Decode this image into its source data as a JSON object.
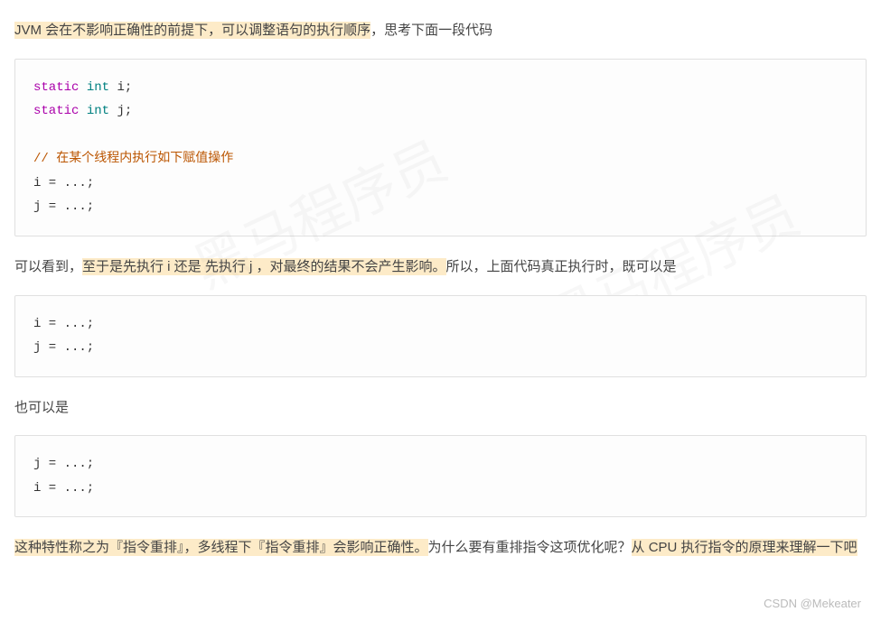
{
  "para1": {
    "hl": "JVM 会在不影响正确性的前提下，可以调整语句的执行顺序",
    "rest": "，思考下面一段代码"
  },
  "code1": {
    "line1_kw1": "static",
    "line1_kw2": "int",
    "line1_var": " i;",
    "line2_kw1": "static",
    "line2_kw2": "int",
    "line2_var": " j;",
    "comment": "// 在某个线程内执行如下赋值操作",
    "line3": "i = ...;",
    "line4": "j = ...;"
  },
  "para2": {
    "pre": "可以看到，",
    "hl": "至于是先执行 i 还是 先执行 j ，对最终的结果不会产生影响。",
    "rest": "所以，上面代码真正执行时，既可以是"
  },
  "code2": {
    "line1": "i = ...;",
    "line2": "j = ...;"
  },
  "para3": "也可以是",
  "code3": {
    "line1": "j = ...;",
    "line2": "i = ...;"
  },
  "para4": {
    "hl1": "这种特性称之为『指令重排』，多线程下『指令重排』会影响正确性。",
    "mid": "为什么要有重排指令这项优化呢？",
    "hl2": "从 CPU 执行指令的原理来理解一下吧"
  },
  "watermark": "CSDN @Mekeater",
  "bg_watermark": "黑马程序员"
}
